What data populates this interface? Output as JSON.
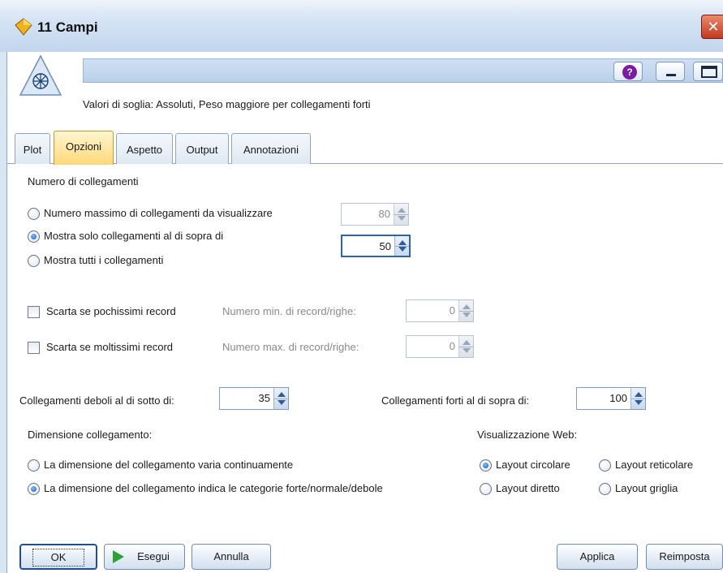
{
  "window": {
    "title": "11 Campi",
    "close_glyph": "✕"
  },
  "header": {
    "summary": "Valori di soglia: Assoluti,   Peso maggiore per collegamenti forti",
    "help_glyph": "?"
  },
  "tabs": [
    {
      "label": "Plot",
      "active": false
    },
    {
      "label": "Opzioni",
      "active": true
    },
    {
      "label": "Aspetto",
      "active": false
    },
    {
      "label": "Output",
      "active": false
    },
    {
      "label": "Annotazioni",
      "active": false
    }
  ],
  "links": {
    "section_label": "Numero di collegamenti",
    "options": [
      {
        "label": "Numero massimo di collegamenti da visualizzare",
        "selected": false
      },
      {
        "label": "Mostra solo collegamenti al di sopra di",
        "selected": true
      },
      {
        "label": "Mostra tutti i collegamenti",
        "selected": false
      }
    ],
    "max_links_value": "80",
    "above_value": "50"
  },
  "discard": {
    "few_label": "Scarta se pochissimi record",
    "few_checked": false,
    "few_sub_label": "Numero min. di record/righe:",
    "few_value": "0",
    "many_label": "Scarta se moltissimi record",
    "many_checked": false,
    "many_sub_label": "Numero max. di record/righe:",
    "many_value": "0"
  },
  "thresholds": {
    "weak_label": "Collegamenti deboli al di sotto di:",
    "weak_value": "35",
    "strong_label": "Collegamenti forti al di sopra di:",
    "strong_value": "100"
  },
  "link_size": {
    "label": "Dimensione collegamento:",
    "options": [
      {
        "label": "La dimensione del collegamento varia continuamente",
        "selected": false
      },
      {
        "label": "La dimensione del collegamento indica le categorie forte/normale/debole",
        "selected": true
      }
    ]
  },
  "web_display": {
    "label": "Visualizzazione Web:",
    "options": [
      {
        "label": "Layout circolare",
        "selected": true
      },
      {
        "label": "Layout reticolare",
        "selected": false
      },
      {
        "label": "Layout diretto",
        "selected": false
      },
      {
        "label": "Layout griglia",
        "selected": false
      }
    ]
  },
  "buttons": {
    "ok": "OK",
    "run": "Esegui",
    "cancel": "Annulla",
    "apply": "Applica",
    "reset": "Reimposta"
  },
  "colors": {
    "active_tab": "#ffd97a",
    "run_icon": "#2aa235",
    "help_icon": "#7a1aa6"
  }
}
